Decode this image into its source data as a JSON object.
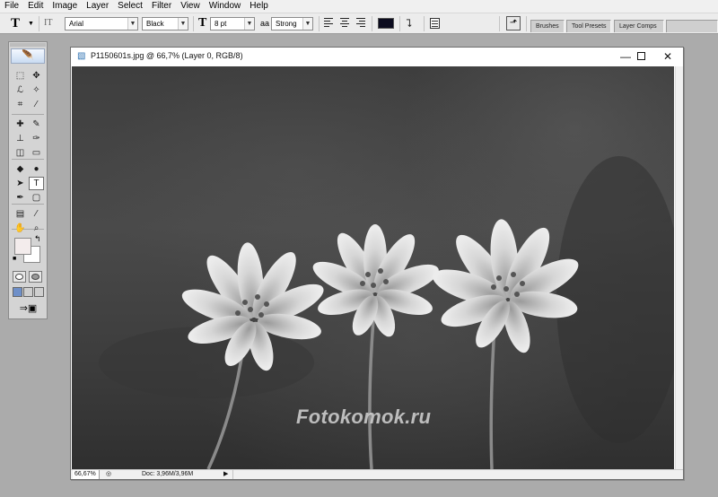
{
  "menu": [
    "File",
    "Edit",
    "Image",
    "Layer",
    "Select",
    "Filter",
    "View",
    "Window",
    "Help"
  ],
  "options_bar": {
    "tool_glyph": "T",
    "orientation_glyph": "IT",
    "font_family": "Arial",
    "font_style": "Black",
    "size_glyph": "T",
    "font_size": "8 pt",
    "aa_glyph": "aa",
    "antialias": "Strong",
    "text_color": "#0b0b1e",
    "warp_glyph": "⮧"
  },
  "palette_well": {
    "tabs": [
      "Brushes",
      "Tool Presets",
      "Layer Comps"
    ]
  },
  "toolbox": {
    "logo_glyph": "🪶",
    "tools": [
      {
        "name": "marquee-tool",
        "glyph": "⬚"
      },
      {
        "name": "move-tool",
        "glyph": "✥"
      },
      {
        "name": "lasso-tool",
        "glyph": "ℒ"
      },
      {
        "name": "magic-wand-tool",
        "glyph": "✧"
      },
      {
        "name": "crop-tool",
        "glyph": "⌗"
      },
      {
        "name": "slice-tool",
        "glyph": "⁄"
      },
      {
        "name": "healing-brush-tool",
        "glyph": "✚"
      },
      {
        "name": "brush-tool",
        "glyph": "✎"
      },
      {
        "name": "clone-stamp-tool",
        "glyph": "⊥"
      },
      {
        "name": "history-brush-tool",
        "glyph": "✑"
      },
      {
        "name": "eraser-tool",
        "glyph": "◫"
      },
      {
        "name": "gradient-tool",
        "glyph": "▭"
      },
      {
        "name": "blur-tool",
        "glyph": "◆"
      },
      {
        "name": "dodge-tool",
        "glyph": "●"
      },
      {
        "name": "path-selection-tool",
        "glyph": "➤"
      },
      {
        "name": "type-tool",
        "glyph": "T"
      },
      {
        "name": "pen-tool",
        "glyph": "✒"
      },
      {
        "name": "shape-tool",
        "glyph": "▢"
      },
      {
        "name": "notes-tool",
        "glyph": "▤"
      },
      {
        "name": "eyedropper-tool",
        "glyph": "⁄"
      },
      {
        "name": "hand-tool",
        "glyph": "✋"
      },
      {
        "name": "zoom-tool",
        "glyph": "⌕"
      }
    ],
    "swap_glyph": "↰",
    "default_glyph": "■",
    "jump_glyph": "⇒▣"
  },
  "document": {
    "icon_glyph": "▧",
    "title": "P1150601s.jpg @ 66,7% (Layer 0, RGB/8)",
    "minimize_glyph": "—",
    "close_glyph": "✕",
    "watermark": "Fotokomok.ru",
    "zoom": "66,67%",
    "status_icon_glyph": "◎",
    "doc_size": "Doc: 3,96M/3,96M",
    "status_arrow_glyph": "▶"
  }
}
